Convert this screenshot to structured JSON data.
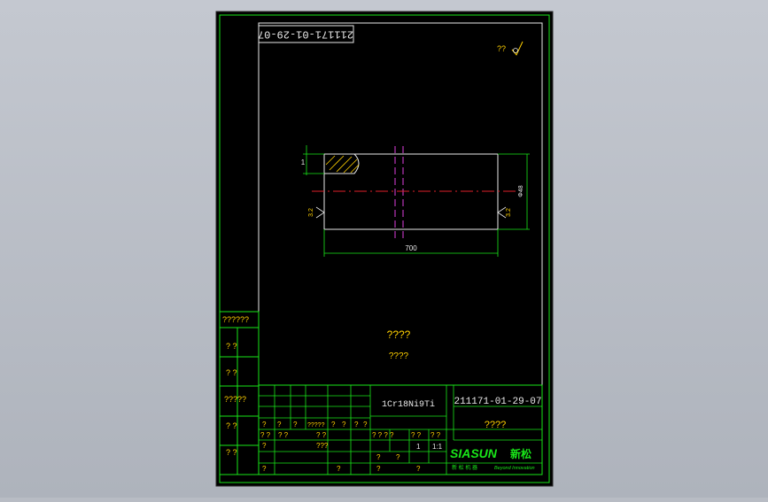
{
  "drawing": {
    "number_rotated": "211171-01-29-07",
    "surface_mark": "??",
    "dims": {
      "length": "700",
      "diameter": "Φ48",
      "rough_right": "3.2",
      "rough_left": "3.2",
      "chamfer": "1"
    },
    "center_text_1": "????",
    "center_text_2": "????"
  },
  "left_strip": {
    "labels": [
      "??????",
      "?  ?",
      "?  ?",
      "?????",
      "?  ?",
      "?  ?"
    ]
  },
  "title_block": {
    "material": "1Cr18Ni9Ti",
    "drawing_number": "211171-01-29-07",
    "part_name": "????",
    "company_logo": "SIASUN",
    "company_logo_cn": "新松",
    "company_sub_cn": "新 松 机 器",
    "company_sub_en": "Beyond Innovation",
    "rev_row": [
      "?",
      "?",
      "?",
      "?????",
      "?",
      "?",
      "?",
      "?"
    ],
    "sign_row": [
      "? ?",
      "?  ?",
      "? ?"
    ],
    "stage_row": [
      "? ? ? ?",
      "? ?",
      "? ?"
    ],
    "check_row": [
      "?",
      "???"
    ],
    "sheet_row": [
      "?",
      "?",
      "1",
      "1:1"
    ],
    "bottom_row": [
      "?",
      "?",
      "?",
      "?"
    ]
  }
}
